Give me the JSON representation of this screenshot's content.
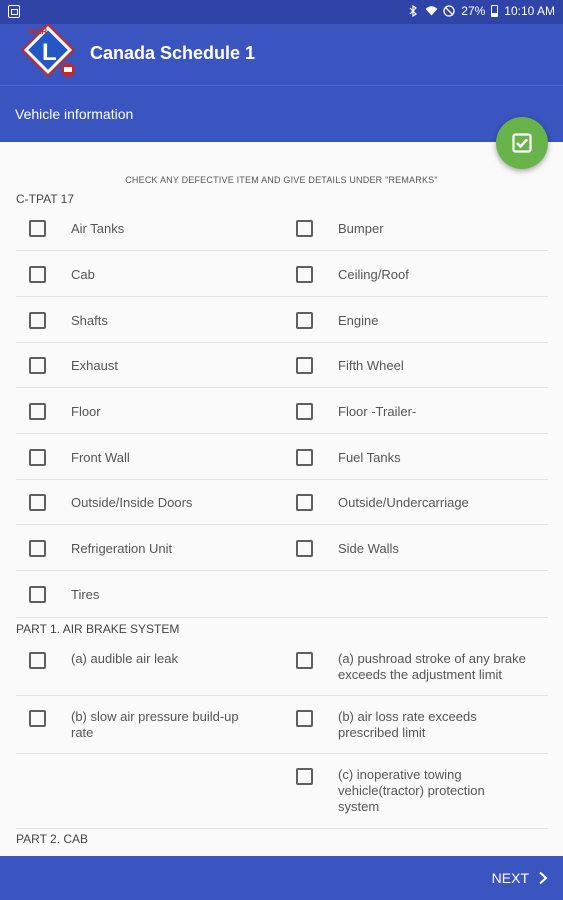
{
  "status_bar": {
    "battery": "27%",
    "time": "10:10 AM"
  },
  "app_bar": {
    "title": "Canada Schedule 1",
    "logo_text": "DVIR"
  },
  "sub_header": {
    "label": "Vehicle information"
  },
  "content": {
    "instruction": "CHECK ANY DEFECTIVE ITEM AND GIVE DETAILS UNDER \"REMARKS\"",
    "sections": [
      {
        "title": "C-TPAT 17",
        "items": [
          "Air Tanks",
          "Bumper",
          "Cab",
          "Ceiling/Roof",
          "Shafts",
          "Engine",
          "Exhaust",
          "Fifth Wheel",
          "Floor",
          "Floor -Trailer-",
          "Front Wall",
          "Fuel Tanks",
          "Outside/Inside Doors",
          "Outside/Undercarriage",
          "Refrigeration Unit",
          "Side Walls",
          "Tires"
        ]
      },
      {
        "title": "PART 1. AIR BRAKE SYSTEM",
        "items": [
          "(a) audible air leak",
          "(a) pushroad stroke of any brake exceeds the adjustment limit",
          "(b) slow air pressure build-up rate",
          "(b) air loss rate exceeds prescribed limit",
          "(c) inoperative towing vehicle(tractor) protection system"
        ]
      },
      {
        "title": "PART 2. CAB"
      }
    ]
  },
  "bottom_bar": {
    "next_label": "NEXT"
  },
  "colors": {
    "primary": "#3a55c0",
    "status": "#2f44a6",
    "fab": "#68b34a"
  }
}
